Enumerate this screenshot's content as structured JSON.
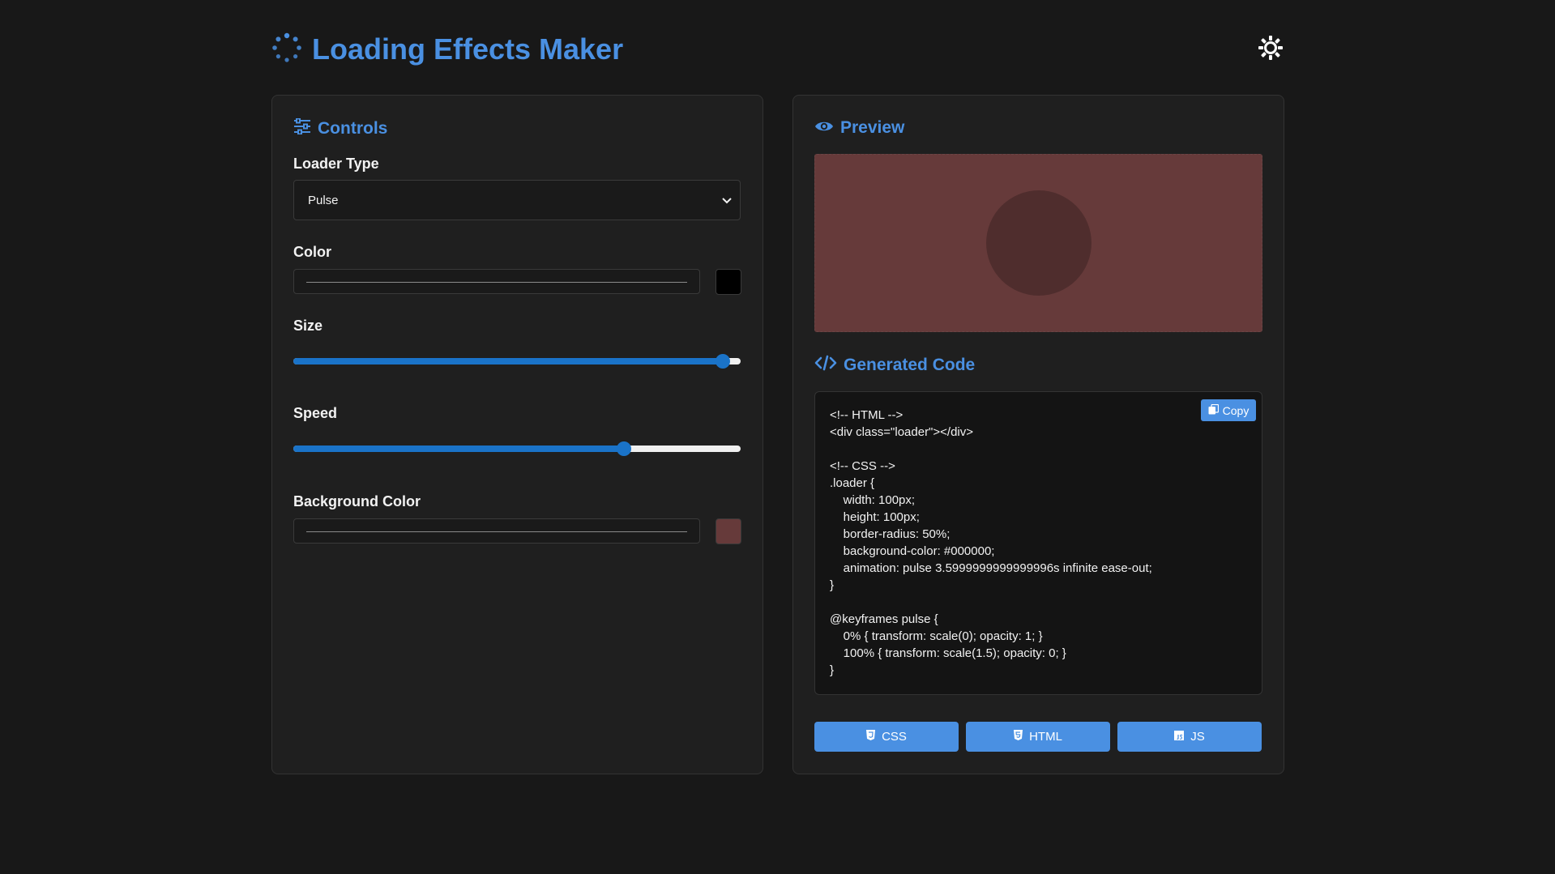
{
  "app": {
    "title": "Loading Effects Maker"
  },
  "header": {
    "theme_toggle_icon": "sun-icon"
  },
  "controls": {
    "title": "Controls",
    "loader_type": {
      "label": "Loader Type",
      "selected": "Pulse"
    },
    "color": {
      "label": "Color",
      "value": "",
      "swatch": "#000000"
    },
    "size": {
      "label": "Size",
      "level": 0.96
    },
    "speed": {
      "label": "Speed",
      "level": 0.74
    },
    "background_color": {
      "label": "Background Color",
      "value": "",
      "swatch": "#663a3a"
    }
  },
  "preview": {
    "title": "Preview",
    "background": "#663a3a",
    "loader_color": "#000000"
  },
  "code": {
    "title": "Generated Code",
    "copy_label": "Copy",
    "text": "<!-- HTML -->\n<div class=\"loader\"></div>\n\n<!-- CSS -->\n.loader {\n    width: 100px;\n    height: 100px;\n    border-radius: 50%;\n    background-color: #000000;\n    animation: pulse 3.5999999999999996s infinite ease-out;\n}\n\n@keyframes pulse {\n    0% { transform: scale(0); opacity: 1; }\n    100% { transform: scale(1.5); opacity: 0; }\n}"
  },
  "export": {
    "css_label": "CSS",
    "html_label": "HTML",
    "js_label": "JS"
  },
  "colors": {
    "accent": "#4a90e2",
    "slider": "#1a73c8",
    "page_bg": "#181818",
    "panel_bg": "#1f1f1f"
  }
}
